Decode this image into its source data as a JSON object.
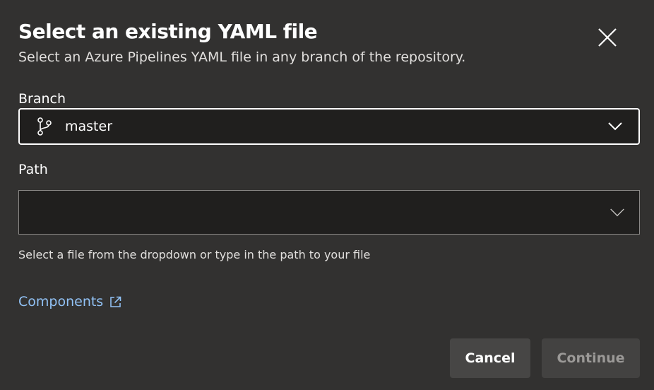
{
  "dialog": {
    "title": "Select an existing YAML file",
    "subtitle": "Select an Azure Pipelines YAML file in any branch of the repository."
  },
  "branch": {
    "label": "Branch",
    "value": "master",
    "icon": "git-branch-icon"
  },
  "path": {
    "label": "Path",
    "value": "",
    "placeholder": "",
    "helper": "Select a file from the dropdown or type in the path to your file"
  },
  "link": {
    "label": "Components",
    "icon": "open-in-new-window-icon"
  },
  "buttons": {
    "cancel": "Cancel",
    "continue": "Continue",
    "continue_disabled": true
  },
  "colors": {
    "background": "#323130",
    "input_background": "#201f1e",
    "link": "#91c1f4",
    "button": "#474645",
    "disabled_text": "#9b9997"
  }
}
